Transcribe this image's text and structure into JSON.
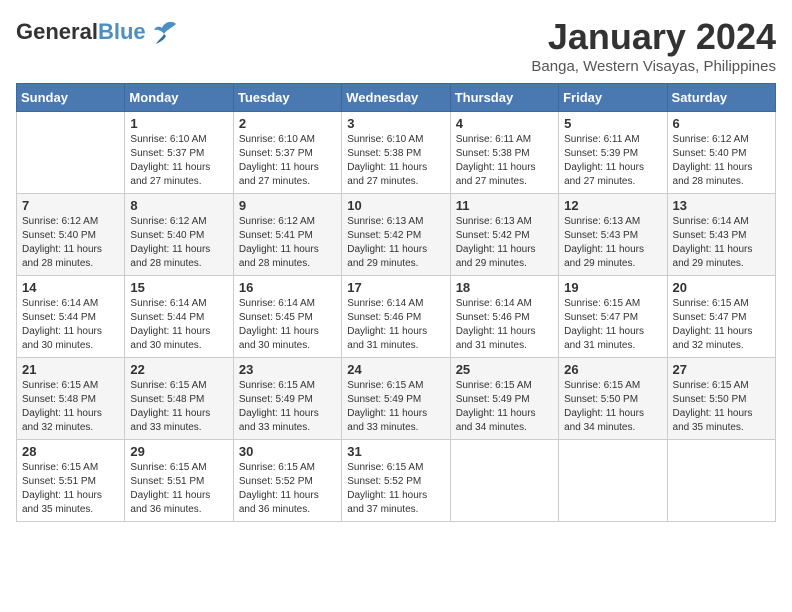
{
  "header": {
    "logo_general": "General",
    "logo_blue": "Blue",
    "month_title": "January 2024",
    "location": "Banga, Western Visayas, Philippines"
  },
  "weekdays": [
    "Sunday",
    "Monday",
    "Tuesday",
    "Wednesday",
    "Thursday",
    "Friday",
    "Saturday"
  ],
  "weeks": [
    [
      {
        "day": "",
        "sunrise": "",
        "sunset": "",
        "daylight": ""
      },
      {
        "day": "1",
        "sunrise": "Sunrise: 6:10 AM",
        "sunset": "Sunset: 5:37 PM",
        "daylight": "Daylight: 11 hours and 27 minutes."
      },
      {
        "day": "2",
        "sunrise": "Sunrise: 6:10 AM",
        "sunset": "Sunset: 5:37 PM",
        "daylight": "Daylight: 11 hours and 27 minutes."
      },
      {
        "day": "3",
        "sunrise": "Sunrise: 6:10 AM",
        "sunset": "Sunset: 5:38 PM",
        "daylight": "Daylight: 11 hours and 27 minutes."
      },
      {
        "day": "4",
        "sunrise": "Sunrise: 6:11 AM",
        "sunset": "Sunset: 5:38 PM",
        "daylight": "Daylight: 11 hours and 27 minutes."
      },
      {
        "day": "5",
        "sunrise": "Sunrise: 6:11 AM",
        "sunset": "Sunset: 5:39 PM",
        "daylight": "Daylight: 11 hours and 27 minutes."
      },
      {
        "day": "6",
        "sunrise": "Sunrise: 6:12 AM",
        "sunset": "Sunset: 5:40 PM",
        "daylight": "Daylight: 11 hours and 28 minutes."
      }
    ],
    [
      {
        "day": "7",
        "sunrise": "Sunrise: 6:12 AM",
        "sunset": "Sunset: 5:40 PM",
        "daylight": "Daylight: 11 hours and 28 minutes."
      },
      {
        "day": "8",
        "sunrise": "Sunrise: 6:12 AM",
        "sunset": "Sunset: 5:40 PM",
        "daylight": "Daylight: 11 hours and 28 minutes."
      },
      {
        "day": "9",
        "sunrise": "Sunrise: 6:12 AM",
        "sunset": "Sunset: 5:41 PM",
        "daylight": "Daylight: 11 hours and 28 minutes."
      },
      {
        "day": "10",
        "sunrise": "Sunrise: 6:13 AM",
        "sunset": "Sunset: 5:42 PM",
        "daylight": "Daylight: 11 hours and 29 minutes."
      },
      {
        "day": "11",
        "sunrise": "Sunrise: 6:13 AM",
        "sunset": "Sunset: 5:42 PM",
        "daylight": "Daylight: 11 hours and 29 minutes."
      },
      {
        "day": "12",
        "sunrise": "Sunrise: 6:13 AM",
        "sunset": "Sunset: 5:43 PM",
        "daylight": "Daylight: 11 hours and 29 minutes."
      },
      {
        "day": "13",
        "sunrise": "Sunrise: 6:14 AM",
        "sunset": "Sunset: 5:43 PM",
        "daylight": "Daylight: 11 hours and 29 minutes."
      }
    ],
    [
      {
        "day": "14",
        "sunrise": "Sunrise: 6:14 AM",
        "sunset": "Sunset: 5:44 PM",
        "daylight": "Daylight: 11 hours and 30 minutes."
      },
      {
        "day": "15",
        "sunrise": "Sunrise: 6:14 AM",
        "sunset": "Sunset: 5:44 PM",
        "daylight": "Daylight: 11 hours and 30 minutes."
      },
      {
        "day": "16",
        "sunrise": "Sunrise: 6:14 AM",
        "sunset": "Sunset: 5:45 PM",
        "daylight": "Daylight: 11 hours and 30 minutes."
      },
      {
        "day": "17",
        "sunrise": "Sunrise: 6:14 AM",
        "sunset": "Sunset: 5:46 PM",
        "daylight": "Daylight: 11 hours and 31 minutes."
      },
      {
        "day": "18",
        "sunrise": "Sunrise: 6:14 AM",
        "sunset": "Sunset: 5:46 PM",
        "daylight": "Daylight: 11 hours and 31 minutes."
      },
      {
        "day": "19",
        "sunrise": "Sunrise: 6:15 AM",
        "sunset": "Sunset: 5:47 PM",
        "daylight": "Daylight: 11 hours and 31 minutes."
      },
      {
        "day": "20",
        "sunrise": "Sunrise: 6:15 AM",
        "sunset": "Sunset: 5:47 PM",
        "daylight": "Daylight: 11 hours and 32 minutes."
      }
    ],
    [
      {
        "day": "21",
        "sunrise": "Sunrise: 6:15 AM",
        "sunset": "Sunset: 5:48 PM",
        "daylight": "Daylight: 11 hours and 32 minutes."
      },
      {
        "day": "22",
        "sunrise": "Sunrise: 6:15 AM",
        "sunset": "Sunset: 5:48 PM",
        "daylight": "Daylight: 11 hours and 33 minutes."
      },
      {
        "day": "23",
        "sunrise": "Sunrise: 6:15 AM",
        "sunset": "Sunset: 5:49 PM",
        "daylight": "Daylight: 11 hours and 33 minutes."
      },
      {
        "day": "24",
        "sunrise": "Sunrise: 6:15 AM",
        "sunset": "Sunset: 5:49 PM",
        "daylight": "Daylight: 11 hours and 33 minutes."
      },
      {
        "day": "25",
        "sunrise": "Sunrise: 6:15 AM",
        "sunset": "Sunset: 5:49 PM",
        "daylight": "Daylight: 11 hours and 34 minutes."
      },
      {
        "day": "26",
        "sunrise": "Sunrise: 6:15 AM",
        "sunset": "Sunset: 5:50 PM",
        "daylight": "Daylight: 11 hours and 34 minutes."
      },
      {
        "day": "27",
        "sunrise": "Sunrise: 6:15 AM",
        "sunset": "Sunset: 5:50 PM",
        "daylight": "Daylight: 11 hours and 35 minutes."
      }
    ],
    [
      {
        "day": "28",
        "sunrise": "Sunrise: 6:15 AM",
        "sunset": "Sunset: 5:51 PM",
        "daylight": "Daylight: 11 hours and 35 minutes."
      },
      {
        "day": "29",
        "sunrise": "Sunrise: 6:15 AM",
        "sunset": "Sunset: 5:51 PM",
        "daylight": "Daylight: 11 hours and 36 minutes."
      },
      {
        "day": "30",
        "sunrise": "Sunrise: 6:15 AM",
        "sunset": "Sunset: 5:52 PM",
        "daylight": "Daylight: 11 hours and 36 minutes."
      },
      {
        "day": "31",
        "sunrise": "Sunrise: 6:15 AM",
        "sunset": "Sunset: 5:52 PM",
        "daylight": "Daylight: 11 hours and 37 minutes."
      },
      {
        "day": "",
        "sunrise": "",
        "sunset": "",
        "daylight": ""
      },
      {
        "day": "",
        "sunrise": "",
        "sunset": "",
        "daylight": ""
      },
      {
        "day": "",
        "sunrise": "",
        "sunset": "",
        "daylight": ""
      }
    ]
  ]
}
